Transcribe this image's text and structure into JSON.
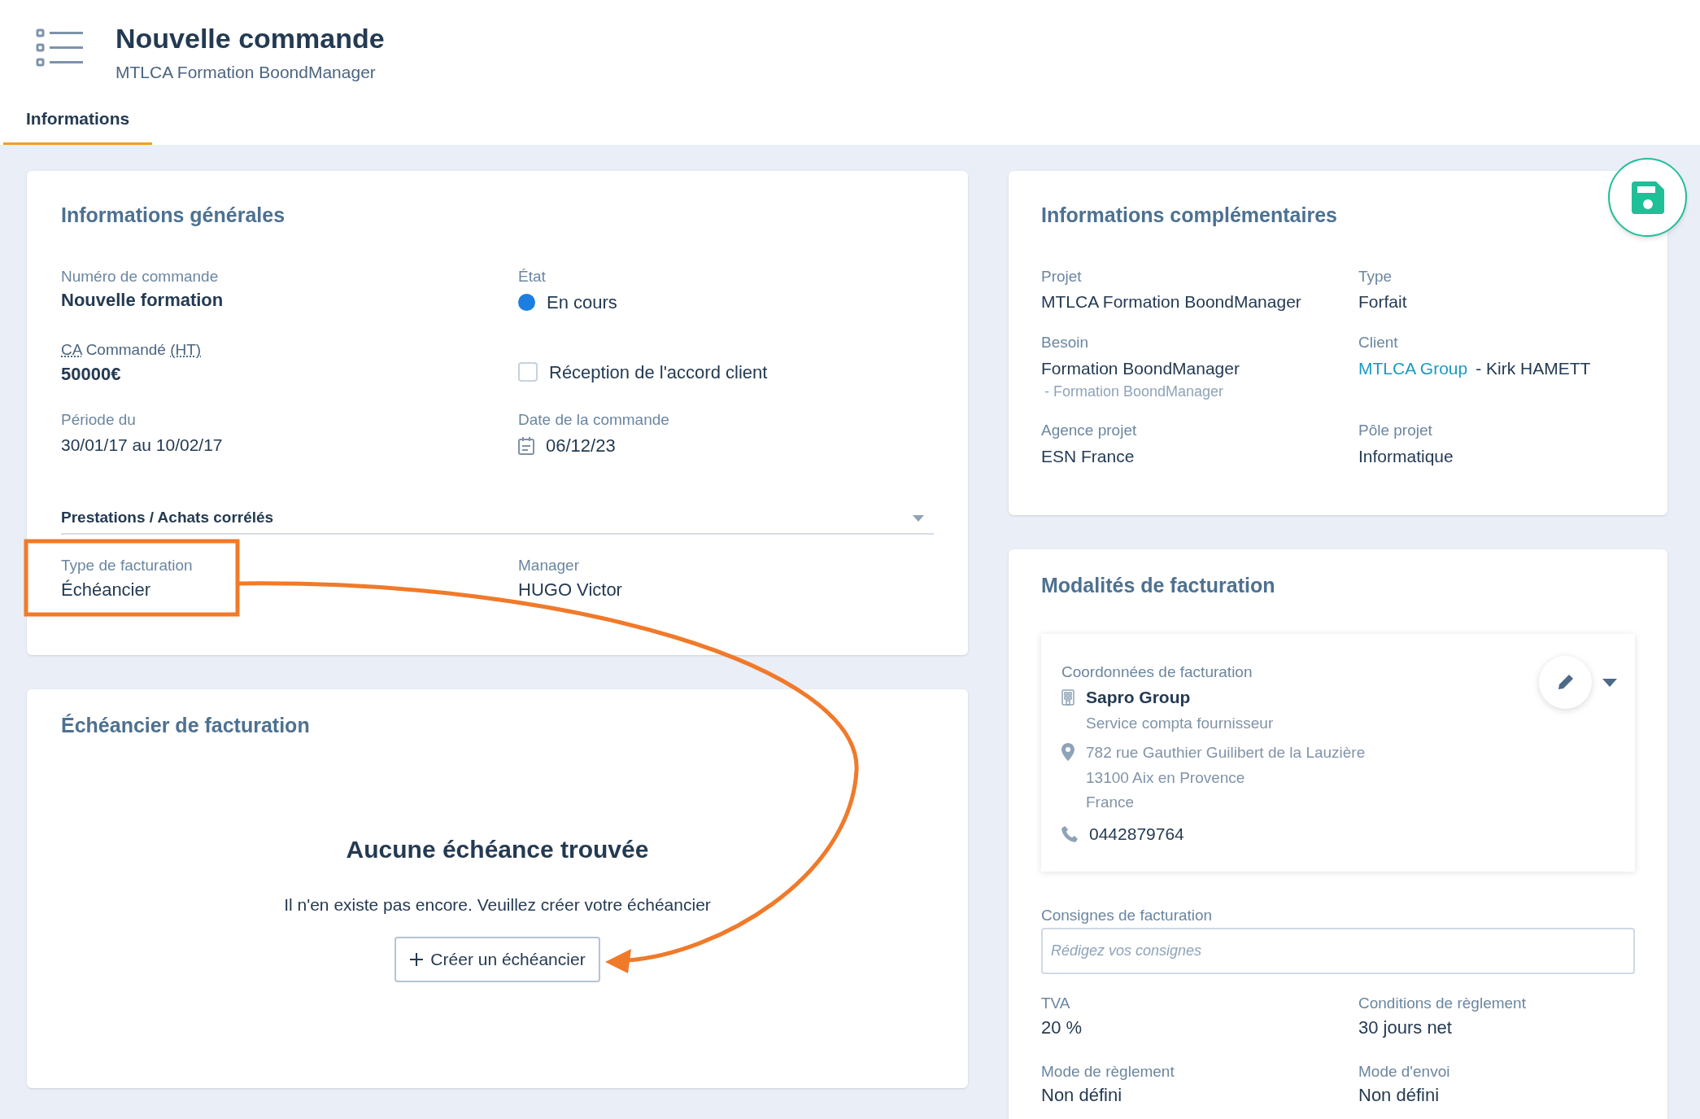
{
  "header": {
    "title": "Nouvelle commande",
    "subtitle": "MTLCA Formation BoondManager"
  },
  "tabs": [
    {
      "label": "Informations",
      "selected": true
    }
  ],
  "general": {
    "title": "Informations générales",
    "order_number": {
      "label": "Numéro de commande",
      "value": "Nouvelle formation"
    },
    "state": {
      "label": "État",
      "value": "En cours",
      "color": "#1a7fe0"
    },
    "amount": {
      "label_parts": [
        "CA",
        "Commandé",
        "(HT)"
      ],
      "value": "50000€"
    },
    "agreement": {
      "label": "Réception de l'accord client",
      "checked": false
    },
    "period": {
      "label": "Période du",
      "value": "30/01/17 au 10/02/17"
    },
    "order_date": {
      "label": "Date de la commande",
      "value": "06/12/23"
    },
    "related": {
      "label": "Prestations / Achats corrélés",
      "expanded": false
    },
    "billing_type": {
      "label": "Type de facturation",
      "value": "Échéancier",
      "highlighted": true
    },
    "manager": {
      "label": "Manager",
      "value": "HUGO Victor"
    }
  },
  "schedule": {
    "title": "Échéancier de facturation",
    "empty_title": "Aucune échéance trouvée",
    "empty_text": "Il n'en existe pas encore. Veuillez créer votre échéancier",
    "button": "Créer un échéancier"
  },
  "complementary": {
    "title": "Informations complémentaires",
    "fields": [
      {
        "kind": "text",
        "label": "Projet",
        "value": "MTLCA Formation BoondManager"
      },
      {
        "kind": "text",
        "label": "Type",
        "value": "Forfait"
      },
      {
        "kind": "sub",
        "label": "Besoin",
        "value": "Formation BoondManager",
        "sub": "- Formation BoondManager"
      },
      {
        "kind": "link",
        "label": "Client",
        "link": "MTLCA Group",
        "value": "- Kirk HAMETT"
      },
      {
        "kind": "text",
        "label": "Agence projet",
        "value": "ESN France"
      },
      {
        "kind": "text",
        "label": "Pôle projet",
        "value": "Informatique"
      }
    ]
  },
  "billing": {
    "title": "Modalités de facturation",
    "contact": {
      "label": "Coordonnées de facturation",
      "company": "Sapro Group",
      "service": "Service compta fournisseur",
      "address": [
        "782 rue Gauthier Guilibert de la Lauzière",
        "13100 Aix en Provence",
        "France"
      ],
      "phone": "0442879764"
    },
    "instructions": {
      "label": "Consignes de facturation",
      "placeholder": "Rédigez vos consignes"
    },
    "fields": [
      {
        "label": "TVA",
        "value": "20 %"
      },
      {
        "label": "Conditions de règlement",
        "value": "30 jours net"
      },
      {
        "label": "Mode de règlement",
        "value": "Non défini"
      },
      {
        "label": "Mode d'envoi",
        "value": "Non défini"
      }
    ]
  }
}
